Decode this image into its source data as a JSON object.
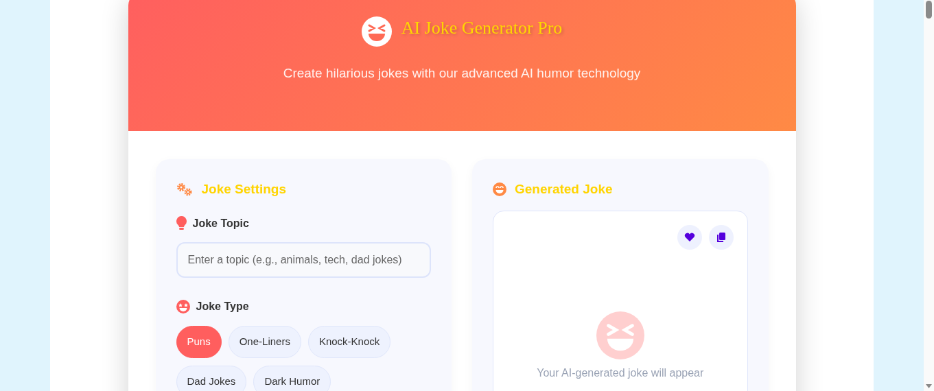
{
  "header": {
    "title": "AI Joke Generator Pro",
    "subtitle": "Create hilarious jokes with our advanced AI humor technology"
  },
  "settings": {
    "heading": "Joke Settings",
    "topic": {
      "label": "Joke Topic",
      "placeholder": "Enter a topic (e.g., animals, tech, dad jokes)"
    },
    "type": {
      "label": "Joke Type",
      "options": [
        {
          "label": "Puns",
          "selected": true
        },
        {
          "label": "One-Liners",
          "selected": false
        },
        {
          "label": "Knock-Knock",
          "selected": false
        },
        {
          "label": "Dad Jokes",
          "selected": false
        },
        {
          "label": "Dark Humor",
          "selected": false
        }
      ]
    }
  },
  "output": {
    "heading": "Generated Joke",
    "actions": [
      {
        "kind": "favorite"
      },
      {
        "kind": "copy"
      }
    ],
    "empty_message": "Your AI-generated joke will appear"
  }
}
